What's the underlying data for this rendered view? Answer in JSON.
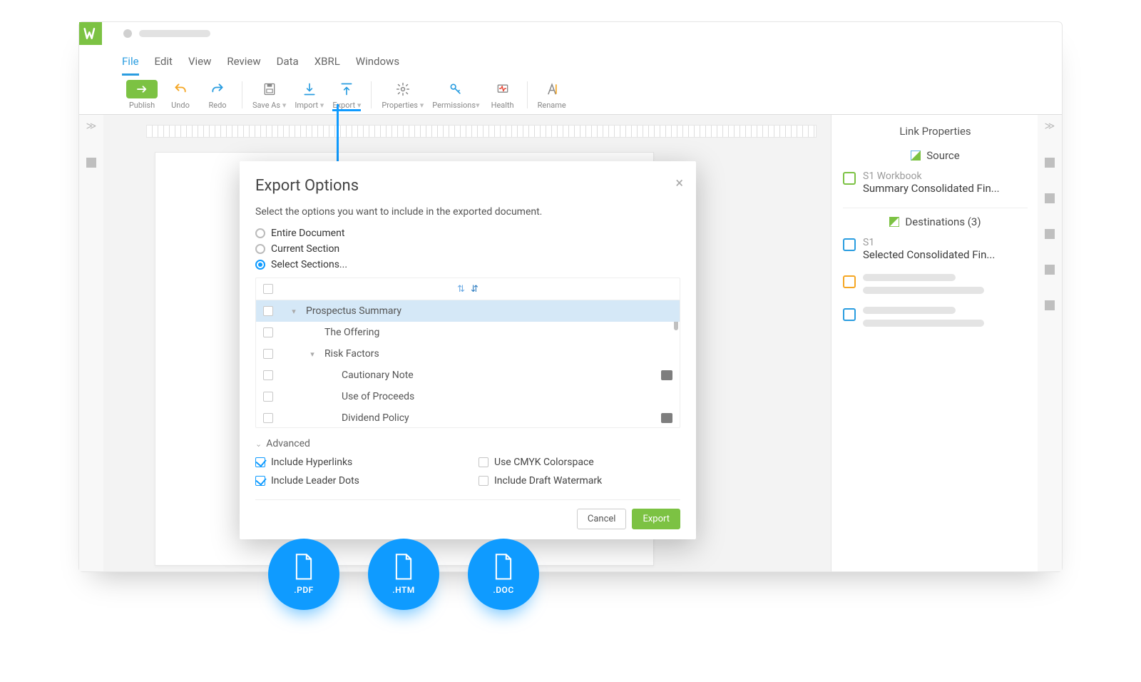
{
  "menubar": [
    "File",
    "Edit",
    "View",
    "Review",
    "Data",
    "XBRL",
    "Windows"
  ],
  "menubar_active_index": 0,
  "toolbar": {
    "publish": "Publish",
    "undo": "Undo",
    "redo": "Redo",
    "saveas": "Save As",
    "import": "Import",
    "export": "Export",
    "properties": "Properties",
    "permissions": "Permissions",
    "health": "Health",
    "rename": "Rename"
  },
  "sidepanel": {
    "title": "Link Properties",
    "source_label": "Source",
    "source_sub": "S1 Workbook",
    "source_val": "Summary Consolidated Fin...",
    "dest_label": "Destinations (3)",
    "dest1_sub": "S1",
    "dest1_val": "Selected Consolidated Fin..."
  },
  "modal": {
    "title": "Export Options",
    "desc": "Select the options you want to include in the exported document.",
    "radios": [
      "Entire Document",
      "Current Section",
      "Select Sections..."
    ],
    "radio_selected": 2,
    "tree": [
      {
        "label": "Prospectus Summary",
        "level": 0,
        "expandable": true,
        "selected": true
      },
      {
        "label": "The Offering",
        "level": 1
      },
      {
        "label": "Risk Factors",
        "level": 1,
        "expandable": true
      },
      {
        "label": "Cautionary Note",
        "level": 2,
        "note": true
      },
      {
        "label": "Use of Proceeds",
        "level": 2
      },
      {
        "label": "Dividend Policy",
        "level": 2,
        "note": true
      }
    ],
    "advanced_label": "Advanced",
    "options": [
      {
        "label": "Include Hyperlinks",
        "on": true
      },
      {
        "label": "Use CMYK Colorspace",
        "on": false
      },
      {
        "label": "Include Leader Dots",
        "on": true
      },
      {
        "label": "Include Draft Watermark",
        "on": false
      }
    ],
    "cancel": "Cancel",
    "export": "Export"
  },
  "bubbles": [
    ".PDF",
    ".HTM",
    ".DOC"
  ]
}
